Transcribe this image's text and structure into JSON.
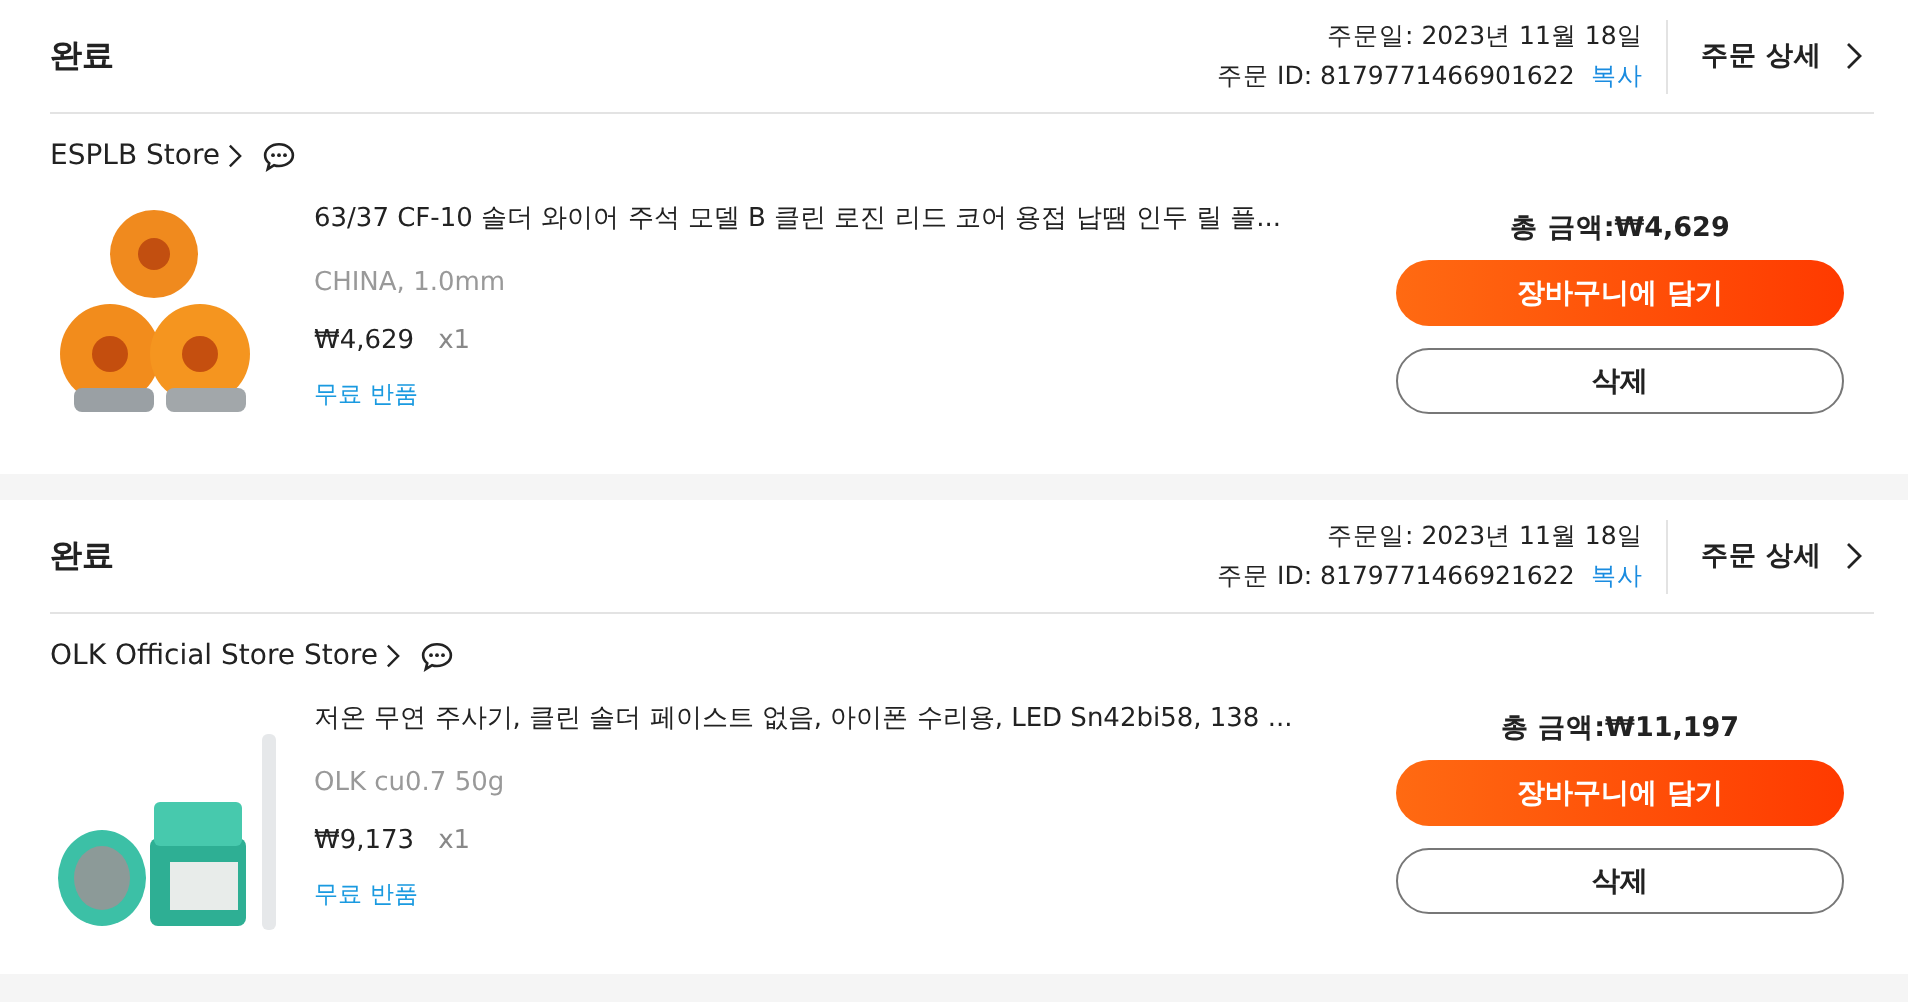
{
  "orders": [
    {
      "status": "완료",
      "order_date": "주문일: 2023년 11월 18일",
      "order_id": "주문 ID: 8179771466901622",
      "copy_link": "복사",
      "details_link": "주문 상세",
      "store": "ESPLB Store",
      "product": {
        "title": "63/37 CF-10 솔더 와이어 주석 모델 B 클린 로진 리드 코어 용접 납땜 인두 릴 플...",
        "variant": "CHINA, 1.0mm",
        "price": "₩4,629",
        "quantity": "x1",
        "free_return": "무료 반품"
      },
      "total": "총 금액:₩4,629",
      "cart_button": "장바구니에 담기",
      "delete_button": "삭제"
    },
    {
      "status": "완료",
      "order_date": "주문일: 2023년 11월 18일",
      "order_id": "주문 ID: 8179771466921622",
      "copy_link": "복사",
      "details_link": "주문 상세",
      "store": "OLK Official Store Store",
      "product": {
        "title": "저온 무연 주사기, 클린 솔더 페이스트 없음, 아이폰 수리용, LED Sn42bi58, 138 ...",
        "variant": "OLK cu0.7 50g",
        "price": "₩9,173",
        "quantity": "x1",
        "free_return": "무료 반품"
      },
      "total": "총 금액:₩11,197",
      "cart_button": "장바구니에 담기",
      "delete_button": "삭제"
    }
  ]
}
